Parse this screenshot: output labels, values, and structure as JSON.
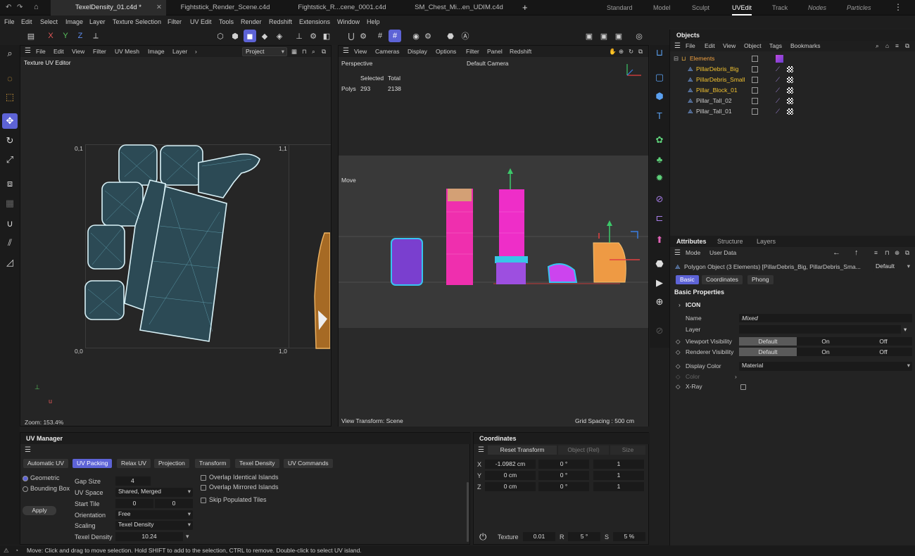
{
  "doc_tabs": [
    "TexelDensity_01.c4d *",
    "Fightstick_Render_Scene.c4d",
    "Fightstick_R...cene_0001.c4d",
    "SM_Chest_Mi...en_UDIM.c4d"
  ],
  "layouts": [
    "Standard",
    "Model",
    "Sculpt",
    "UVEdit",
    "Track",
    "Nodes",
    "Particles"
  ],
  "active_layout": "UVEdit",
  "menu": [
    "File",
    "Edit",
    "Select",
    "Image",
    "Layer",
    "Texture Selection",
    "Filter",
    "UV Edit",
    "Tools",
    "Render",
    "Redshift",
    "Extensions",
    "Window",
    "Help"
  ],
  "axis_buttons": {
    "x": "X",
    "y": "Y",
    "z": "Z"
  },
  "uv_editor": {
    "menu": [
      "File",
      "Edit",
      "View",
      "Filter",
      "UV Mesh",
      "Image",
      "Layer"
    ],
    "project_select": "Project",
    "title": "Texture UV Editor",
    "corner_01": "0,1",
    "corner_11": "1,1",
    "corner_00": "0,0",
    "corner_10": "1,0",
    "zoom": "Zoom: 153.4%"
  },
  "viewport": {
    "menu": [
      "View",
      "Cameras",
      "Display",
      "Options",
      "Filter",
      "Panel",
      "Redshift"
    ],
    "perspective": "Perspective",
    "camera": "Default Camera",
    "stats_selected_h": "Selected",
    "stats_total_h": "Total",
    "stats_polys": "Polys",
    "stats_sel": "293",
    "stats_total": "2138",
    "move_label": "Move",
    "view_transform": "View Transform: Scene",
    "grid_spacing": "Grid Spacing : 500 cm"
  },
  "objects": {
    "title": "Objects",
    "menu": [
      "File",
      "Edit",
      "View",
      "Object",
      "Tags",
      "Bookmarks"
    ],
    "root": "Elements",
    "items": [
      {
        "name": "PillarDebris_Big",
        "selected": true
      },
      {
        "name": "PillarDebris_Small",
        "selected": true
      },
      {
        "name": "Pillar_Block_01",
        "selected": true
      },
      {
        "name": "Pillar_Tall_02",
        "selected": false
      },
      {
        "name": "Pillar_Tall_01",
        "selected": false
      }
    ]
  },
  "attributes": {
    "tabs": [
      "Attributes",
      "Structure",
      "Layers"
    ],
    "mode": "Mode",
    "user_data": "User Data",
    "object_desc": "Polygon Object (3 Elements) [PillarDebris_Big, PillarDebris_Sma...",
    "preset": "Default",
    "sub_tabs": [
      "Basic",
      "Coordinates",
      "Phong"
    ],
    "section": "Basic Properties",
    "icon_group": "ICON",
    "name_label": "Name",
    "name_value": "Mixed",
    "layer_label": "Layer",
    "viewport_vis": "Viewport Visibility",
    "renderer_vis": "Renderer Visibility",
    "vis_options": [
      "Default",
      "On",
      "Off"
    ],
    "display_color": "Display Color",
    "display_color_value": "Material",
    "color": "Color",
    "xray": "X-Ray"
  },
  "uv_manager": {
    "title": "UV Manager",
    "tabs": [
      "Automatic UV",
      "UV Packing",
      "Relax UV",
      "Projection",
      "Transform",
      "Texel Density",
      "UV Commands"
    ],
    "active_tab": "UV Packing",
    "radio_geometric": "Geometric",
    "radio_bounding": "Bounding Box",
    "apply": "Apply",
    "gap_size_label": "Gap Size",
    "gap_size": "4",
    "uv_space_label": "UV Space",
    "uv_space": "Shared, Merged",
    "start_tile_label": "Start Tile",
    "start_tile_u": "0",
    "start_tile_v": "0",
    "orientation_label": "Orientation",
    "orientation": "Free",
    "scaling_label": "Scaling",
    "scaling": "Texel Density",
    "texel_density_label": "Texel Density",
    "texel_density": "10.24",
    "overlap_identical": "Overlap Identical Islands",
    "overlap_mirrored": "Overlap Mirrored Islands",
    "skip_populated": "Skip Populated Tiles"
  },
  "coordinates": {
    "title": "Coordinates",
    "reset": "Reset Transform",
    "object_rel": "Object (Rel)",
    "size": "Size",
    "rows": [
      {
        "axis": "X",
        "pos": "-1.0982 cm",
        "rot": "0 °",
        "scale": "1"
      },
      {
        "axis": "Y",
        "pos": "0 cm",
        "rot": "0 °",
        "scale": "1"
      },
      {
        "axis": "Z",
        "pos": "0 cm",
        "rot": "0 °",
        "scale": "1"
      }
    ],
    "texture_label": "Texture",
    "texture_val": "0.01",
    "r_label": "R",
    "r_val": "5 °",
    "s_label": "S",
    "s_val": "5 %"
  },
  "status": "Move: Click and drag to move selection. Hold SHIFT to add to the selection, CTRL to remove. Double-click to select UV island.",
  "colors": {
    "accent": "#5d63d6",
    "uv_island": "#4fb7d0",
    "orange_island": "#d08a32",
    "selected_obj": "#f2c230"
  }
}
